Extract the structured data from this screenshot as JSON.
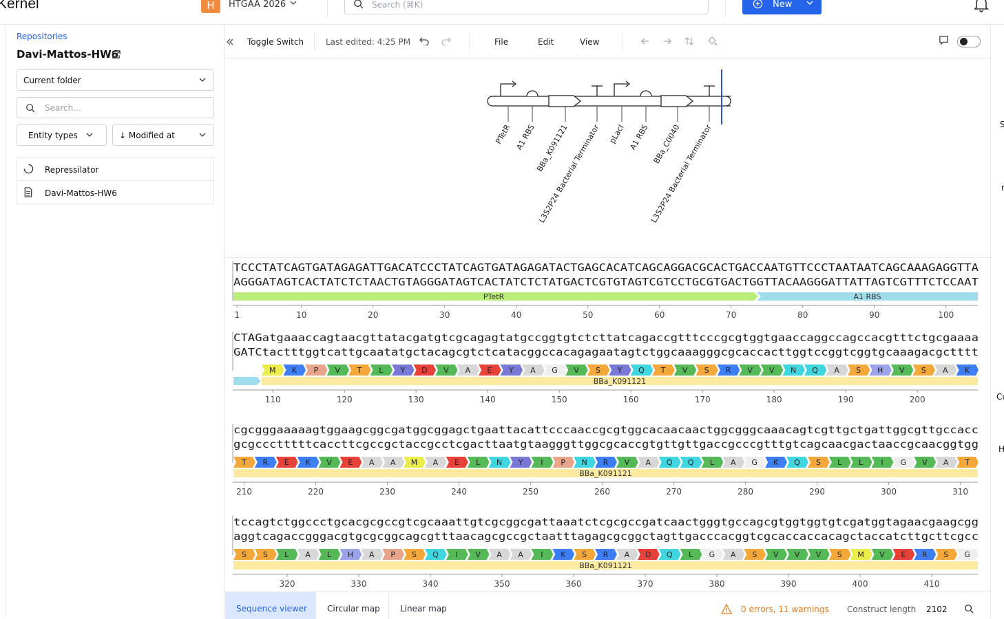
{
  "app": {
    "brand": "Kernel",
    "org_initial": "H",
    "org_name": "HTGAA 2026",
    "search_placeholder": "Search (⌘K)",
    "new_label": "New"
  },
  "sidebar": {
    "breadcrumb": "Repositories",
    "project_title": "Davi-Mattos-HW6",
    "folder_select": "Current folder",
    "search_placeholder": "Search...",
    "filter_entity": "Entity types",
    "sort": "↓ Modified at",
    "items": [
      {
        "label": "Repressilator",
        "icon": "loading-circle-icon"
      },
      {
        "label": "Davi-Mattos-HW6",
        "icon": "document-icon"
      }
    ]
  },
  "toolbar": {
    "title": "Toggle Switch",
    "last_edited": "Last edited: 4:25 PM",
    "menu_file": "File",
    "menu_edit": "Edit",
    "menu_view": "View"
  },
  "map": {
    "parts": [
      {
        "label": "PTetR",
        "type": "promoter"
      },
      {
        "label": "A1 RBS",
        "type": "rbs"
      },
      {
        "label": "BBa_K091121",
        "type": "cds"
      },
      {
        "label": "L3S2P24 Bacterial Terminator",
        "type": "terminator"
      },
      {
        "label": "pLacI",
        "type": "promoter"
      },
      {
        "label": "A1 RBS",
        "type": "rbs"
      },
      {
        "label": "BBa_C0040",
        "type": "cds"
      },
      {
        "label": "L3S2P24 Bacterial Terminator",
        "type": "terminator"
      }
    ]
  },
  "sequence": {
    "rows": [
      {
        "top": "TCCCTATCAGTGATAGAGATTGACATCCCTATCAGTGATAGAGATACTGAGCACATCAGCAGGACGCACTGACCAATGTTCCCTAATAATCAGCAAAGAGGTTA",
        "bottom": "AGGGATAGTCACTATCTCTAACTGTAGGGATAGTCACTATCTCTATGACTCGTGTAGTCGTCCTGCGTGACTGGTTACAAGGGATTATTAGTCGTTTCTCCAAT",
        "ticks": [
          "1",
          "10",
          "20",
          "30",
          "40",
          "50",
          "60",
          "70",
          "80",
          "90",
          "100"
        ],
        "aa": [],
        "features": [
          {
            "label": "PTetR",
            "color": "#b9ec7a"
          },
          {
            "label": "A1 RBS",
            "color": "#9fdcec"
          }
        ]
      },
      {
        "top": "CTAGatgaaaccagtaacgttatacgatgtcgcagagtatgccggtgtctcttatcagaccgtttcccgcgtggtgaaccaggccagccacgtttctgcgaaaa",
        "bottom": "GATCtactttggtcattgcaatatgctacagcgtctcatacggccacagagaatagtctggcaaagggcgcaccacttggtccggtcggtgcaaagacgctttt",
        "ticks": [
          "110",
          "120",
          "130",
          "140",
          "150",
          "160",
          "170",
          "180",
          "190",
          "200"
        ],
        "aa": [
          "M",
          "K",
          "P",
          "V",
          "T",
          "L",
          "Y",
          "D",
          "V",
          "A",
          "E",
          "Y",
          "A",
          "G",
          "V",
          "S",
          "Y",
          "Q",
          "T",
          "V",
          "S",
          "R",
          "V",
          "V",
          "N",
          "Q",
          "A",
          "S",
          "H",
          "V",
          "S",
          "A",
          "K"
        ],
        "features": [
          {
            "label": "",
            "color": "#9fdcec"
          },
          {
            "label": "BBa_K091121",
            "color": "#fbeaa0"
          }
        ]
      },
      {
        "top": "cgcgggaaaaagtggaagcggcgatggcggagctgaattacattcccaaccgcgtggcacaacaactggcgggcaaacagtcgttgctgattggcgttgccacc",
        "bottom": "gcgccctttttcaccttcgccgctaccgcctcgacttaatgtaagggttggcgcaccgtgttgttgaccgcccgtttgtcagcaacgactaaccgcaacggtgg",
        "ticks": [
          "210",
          "220",
          "230",
          "240",
          "250",
          "260",
          "270",
          "280",
          "290",
          "300",
          "310"
        ],
        "aa": [
          "T",
          "R",
          "E",
          "K",
          "V",
          "E",
          "A",
          "A",
          "M",
          "A",
          "E",
          "L",
          "N",
          "Y",
          "I",
          "P",
          "N",
          "R",
          "V",
          "A",
          "Q",
          "Q",
          "L",
          "A",
          "G",
          "K",
          "Q",
          "S",
          "L",
          "L",
          "I",
          "G",
          "V",
          "A",
          "T"
        ],
        "features": [
          {
            "label": "BBa_K091121",
            "color": "#fbeaa0"
          }
        ]
      },
      {
        "top": "tccagtctggccctgcacgcgccgtcgcaaattgtcgcggcgattaaatctcgcgccgatcaactgggtgccagcgtggtggtgtcgatggtagaacgaagcgg",
        "bottom": "aggtcagaccgggacgtgcgcggcagcgtttaacagcgccgctaatttagagcgcggctagttgacccacggtcgcaccaccacagctaccatcttgcttcgcc",
        "ticks": [
          "320",
          "330",
          "340",
          "350",
          "360",
          "370",
          "380",
          "390",
          "400",
          "410"
        ],
        "aa": [
          "S",
          "S",
          "L",
          "A",
          "L",
          "H",
          "A",
          "P",
          "S",
          "Q",
          "I",
          "V",
          "A",
          "A",
          "I",
          "K",
          "S",
          "R",
          "A",
          "D",
          "Q",
          "L",
          "G",
          "A",
          "S",
          "V",
          "V",
          "V",
          "S",
          "M",
          "V",
          "E",
          "R",
          "S",
          "G"
        ],
        "features": [
          {
            "label": "BBa_K091121",
            "color": "#fbeaa0"
          }
        ]
      }
    ]
  },
  "aa_colors": {
    "M": "#ecec4a",
    "K": "#3d7ef5",
    "P": "#e8a58c",
    "V": "#56b957",
    "T": "#f5a83a",
    "L": "#56b957",
    "Y": "#7a78d6",
    "D": "#e8413a",
    "A": "#d7d7d7",
    "E": "#e8413a",
    "G": "#eeeeee",
    "S": "#f5a83a",
    "Q": "#3fd6e0",
    "R": "#3d7ef5",
    "N": "#3fd6e0",
    "H": "#9aa2e8",
    "I": "#56b957"
  },
  "bottom": {
    "tabs": [
      "Sequence viewer",
      "Circular map",
      "Linear map"
    ],
    "warnings": "0 errors, 11 warnings",
    "construct_label": "Construct length",
    "construct_value": "2102"
  },
  "right_edge": [
    "S",
    "n",
    "Cu",
    "H"
  ]
}
